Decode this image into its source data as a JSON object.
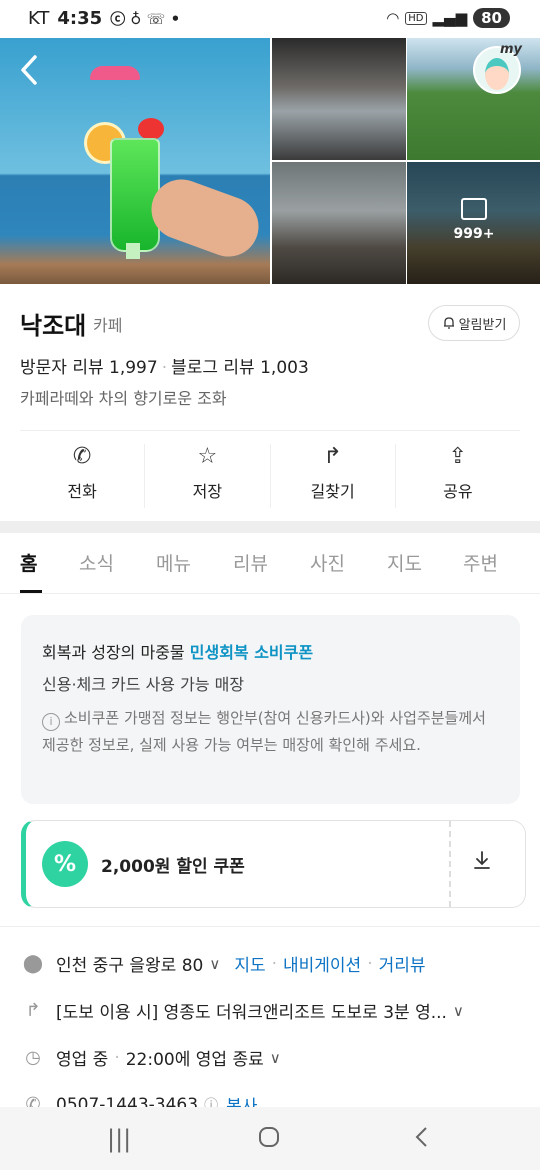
{
  "status_bar": {
    "carrier": "KT",
    "time": "4:35",
    "battery": "80"
  },
  "gallery": {
    "more_label": "999+",
    "profile_badge": "my"
  },
  "place": {
    "name": "낙조대",
    "category": "카페",
    "notify_label": "알림받기",
    "visitor_reviews": "방문자 리뷰 1,997",
    "blog_reviews": "블로그 리뷰 1,003",
    "description": "카페라떼와 차의 향기로운 조화"
  },
  "actions": [
    {
      "label": "전화",
      "icon": "phone-icon"
    },
    {
      "label": "저장",
      "icon": "star-icon"
    },
    {
      "label": "길찾기",
      "icon": "directions-icon"
    },
    {
      "label": "공유",
      "icon": "share-icon"
    }
  ],
  "tabs": [
    "홈",
    "소식",
    "메뉴",
    "리뷰",
    "사진",
    "지도",
    "주변"
  ],
  "notice": {
    "head_prefix": "회복과 성장의 마중물 ",
    "head_highlight": "민생회복 소비쿠폰",
    "sub": "신용·체크 카드 사용 가능 매장",
    "note": "소비쿠폰 가맹점 정보는 행안부(참여 신용카드사)와 사업주분들께서 제공한 정보로, 실제 사용 가능 여부는 매장에 확인해 주세요."
  },
  "coupon": {
    "badge": "%",
    "text": "2,000원 할인 쿠폰"
  },
  "details": {
    "address": "인천 중구 을왕로 80",
    "map_link": "지도",
    "navi_link": "내비게이션",
    "street_link": "거리뷰",
    "directions": "[도보 이용 시] 영종도 더워크앤리조트 도보로 3분 영...",
    "hours_status": "영업 중",
    "hours_detail": "22:00에 영업 종료",
    "phone": "0507-1443-3463",
    "copy_label": "복사"
  },
  "colors": {
    "accent_blue": "#0d93c4",
    "link_blue": "#0d73c4",
    "coupon_green": "#2fd3a1"
  }
}
